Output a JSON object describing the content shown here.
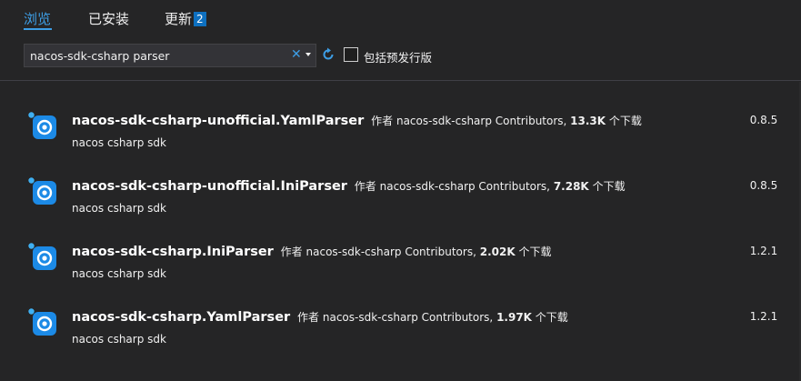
{
  "tabs": [
    {
      "label": "浏览",
      "active": true
    },
    {
      "label": "已安装",
      "active": false
    },
    {
      "label": "更新",
      "active": false,
      "badge": "2"
    }
  ],
  "search": {
    "value": "nacos-sdk-csharp parser",
    "clear_icon": "close-icon",
    "dropdown_icon": "chevron-down-icon"
  },
  "refresh_icon": "refresh-icon",
  "prerelease": {
    "label": "包括预发行版",
    "checked": false
  },
  "packages": [
    {
      "name": "nacos-sdk-csharp-unofficial.YamlParser",
      "author_prefix": "作者",
      "author": "nacos-sdk-csharp Contributors,",
      "downloads": "13.3K",
      "downloads_suffix": "个下载",
      "description": "nacos csharp sdk",
      "version": "0.8.5"
    },
    {
      "name": "nacos-sdk-csharp-unofficial.IniParser",
      "author_prefix": "作者",
      "author": "nacos-sdk-csharp Contributors,",
      "downloads": "7.28K",
      "downloads_suffix": "个下载",
      "description": "nacos csharp sdk",
      "version": "0.8.5"
    },
    {
      "name": "nacos-sdk-csharp.IniParser",
      "author_prefix": "作者",
      "author": "nacos-sdk-csharp Contributors,",
      "downloads": "2.02K",
      "downloads_suffix": "个下载",
      "description": "nacos csharp sdk",
      "version": "1.2.1"
    },
    {
      "name": "nacos-sdk-csharp.YamlParser",
      "author_prefix": "作者",
      "author": "nacos-sdk-csharp Contributors,",
      "downloads": "1.97K",
      "downloads_suffix": "个下载",
      "description": "nacos csharp sdk",
      "version": "1.2.1"
    }
  ],
  "colors": {
    "background": "#252526",
    "accent": "#3d9ee6",
    "badge": "#0e70c0",
    "text": "#f1f1f1"
  }
}
